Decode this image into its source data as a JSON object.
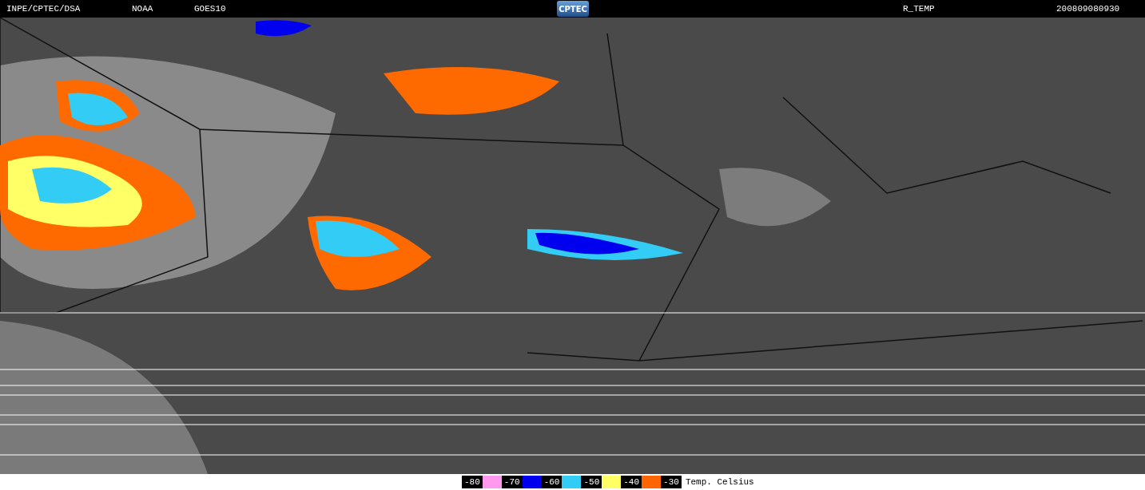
{
  "header": {
    "source": "INPE/CPTEC/DSA",
    "agency": "NOAA",
    "satellite": "GOES10",
    "logo": "CPTEC",
    "product": "R_TEMP",
    "timestamp": "200809080930"
  },
  "legend": {
    "steps": [
      {
        "label": "-80",
        "color": "#ff99ee"
      },
      {
        "label": "-70",
        "color": "#0000ee"
      },
      {
        "label": "-60",
        "color": "#33ccf5"
      },
      {
        "label": "-50",
        "color": "#ffff66"
      },
      {
        "label": "-40",
        "color": "#ff6600"
      },
      {
        "label": "-30"
      }
    ],
    "unit": "Temp. Celsius"
  }
}
